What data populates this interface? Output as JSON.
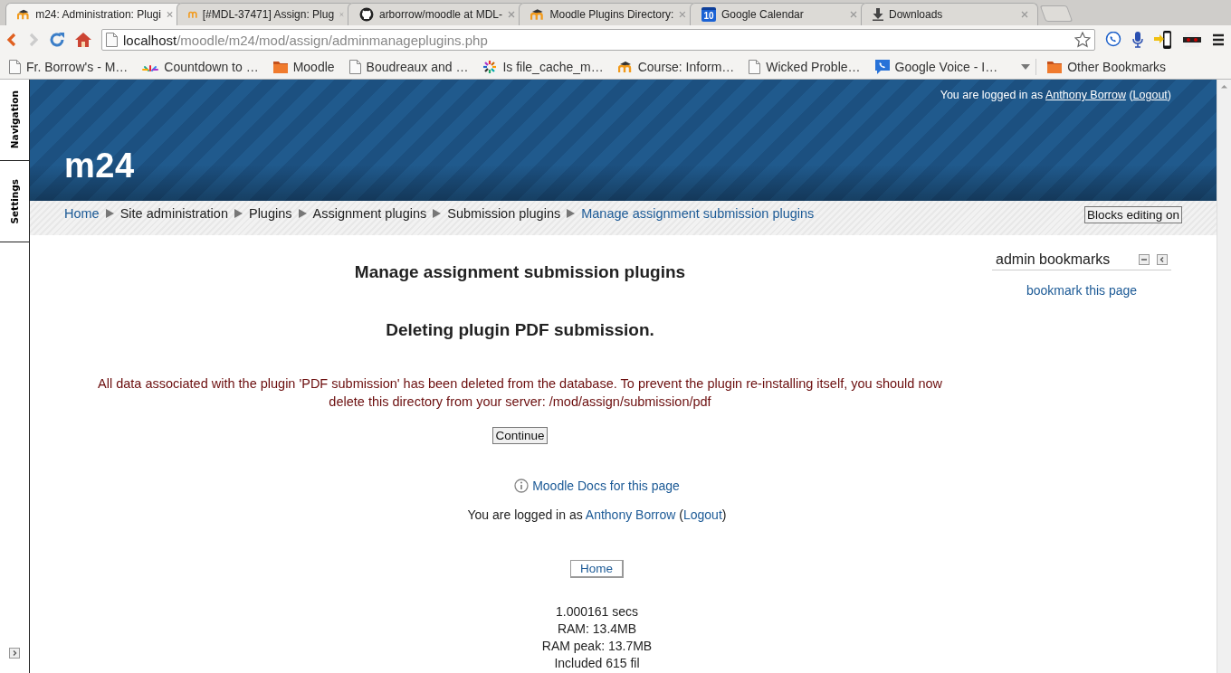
{
  "browser": {
    "tabs": [
      {
        "title": "m24: Administration: Plugi",
        "kind": "moodle",
        "selected": true
      },
      {
        "title": "[#MDL-37471] Assign: Plug",
        "kind": "m",
        "selected": false
      },
      {
        "title": "arborrow/moodle at MDL-",
        "kind": "github",
        "selected": false
      },
      {
        "title": "Moodle Plugins Directory:",
        "kind": "moodle",
        "selected": false
      },
      {
        "title": "Google Calendar",
        "kind": "calendar",
        "badge": "10",
        "selected": false
      },
      {
        "title": "Downloads",
        "kind": "download",
        "selected": false
      }
    ],
    "address": {
      "host": "localhost",
      "path": "/moodle/m24/mod/assign/adminmanageplugins.php"
    },
    "bookmarks": [
      {
        "label": "Fr. Borrow's - M…",
        "kind": "page"
      },
      {
        "label": "Countdown to …",
        "kind": "burst"
      },
      {
        "label": "Moodle",
        "kind": "folder"
      },
      {
        "label": "Boudreaux and …",
        "kind": "page"
      },
      {
        "label": "Is file_cache_m…",
        "kind": "ring"
      },
      {
        "label": "Course: Inform…",
        "kind": "moodle"
      },
      {
        "label": "Wicked Proble…",
        "kind": "page"
      },
      {
        "label": "Google Voice - I…",
        "kind": "phone"
      }
    ],
    "other_bookmarks": "Other Bookmarks"
  },
  "dock": {
    "items": [
      "Navigation",
      "Settings"
    ]
  },
  "header": {
    "login": [
      {
        "kind": "text",
        "text": "You are logged in as "
      },
      {
        "kind": "link",
        "text": "Anthony Borrow"
      },
      {
        "kind": "text",
        "text": " ("
      },
      {
        "kind": "link",
        "text": "Logout"
      },
      {
        "kind": "text",
        "text": ")"
      }
    ],
    "site_name": "m24"
  },
  "breadcrumb": {
    "items": [
      {
        "label": "Home",
        "kind": "link"
      },
      {
        "label": "Site administration",
        "kind": "text"
      },
      {
        "label": "Plugins",
        "kind": "text"
      },
      {
        "label": "Assignment plugins",
        "kind": "text"
      },
      {
        "label": "Submission plugins",
        "kind": "text"
      },
      {
        "label": "Manage assignment submission plugins",
        "kind": "link"
      }
    ],
    "button": "Blocks editing on"
  },
  "main": {
    "heading": "Manage assignment submission plugins",
    "subheading": "Deleting plugin PDF submission.",
    "message": "All data associated with the plugin 'PDF submission' has been deleted from the database. To prevent the plugin re-installing itself, you should now delete this directory from your server: /mod/assign/submission/pdf",
    "continue": "Continue"
  },
  "block": {
    "title": "admin bookmarks",
    "link": "bookmark this page"
  },
  "footer": {
    "docs_link": "Moodle Docs for this page",
    "login": [
      {
        "kind": "text",
        "text": "You are logged in as "
      },
      {
        "kind": "link",
        "text": "Anthony Borrow"
      },
      {
        "kind": "text",
        "text": " ("
      },
      {
        "kind": "link",
        "text": "Logout"
      },
      {
        "kind": "text",
        "text": ")"
      }
    ],
    "home_button": "Home",
    "stats": [
      "1.000161 secs",
      "RAM: 13.4MB",
      "RAM peak: 13.7MB",
      "Included 615 fil"
    ]
  }
}
